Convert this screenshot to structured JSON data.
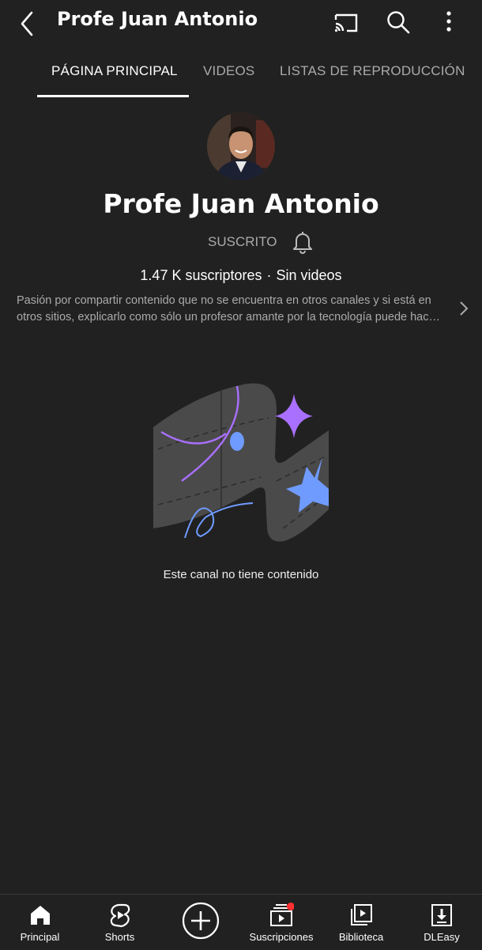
{
  "header": {
    "title": "Profe Juan Antonio",
    "icons": [
      "back-icon",
      "cast-icon",
      "search-icon",
      "more-vert-icon"
    ]
  },
  "tabs": [
    {
      "label": "PÁGINA PRINCIPAL",
      "active": true
    },
    {
      "label": "VIDEOS",
      "active": false
    },
    {
      "label": "LISTAS DE REPRODUCCIÓN",
      "active": false
    }
  ],
  "channel": {
    "name": "Profe Juan Antonio",
    "subscribe_label": "SUSCRITO",
    "subscribers": "1.47 K suscriptores",
    "separator": "·",
    "videos": "Sin videos",
    "description_line1": "Pasión por compartir contenido que no se encuentra en otros canales y si está en",
    "description_line2": "otros sitios, explicarlo como sólo un profesor amante por la tecnología puede hac…"
  },
  "empty_state": {
    "text": "Este canal no tiene contenido"
  },
  "bottom_nav": [
    {
      "label": "Principal",
      "icon": "home-icon"
    },
    {
      "label": "Shorts",
      "icon": "shorts-icon"
    },
    {
      "label": "",
      "icon": "create-icon"
    },
    {
      "label": "Suscripciones",
      "icon": "subscriptions-icon",
      "badge": true
    },
    {
      "label": "Biblioteca",
      "icon": "library-icon"
    },
    {
      "label": "DLEasy",
      "icon": "download-icon"
    }
  ],
  "colors": {
    "background": "#212121",
    "secondary_text": "#aaaaaa",
    "accent_purple": "#a970ff",
    "accent_blue": "#6f9bff",
    "badge_red": "#ff3030"
  }
}
